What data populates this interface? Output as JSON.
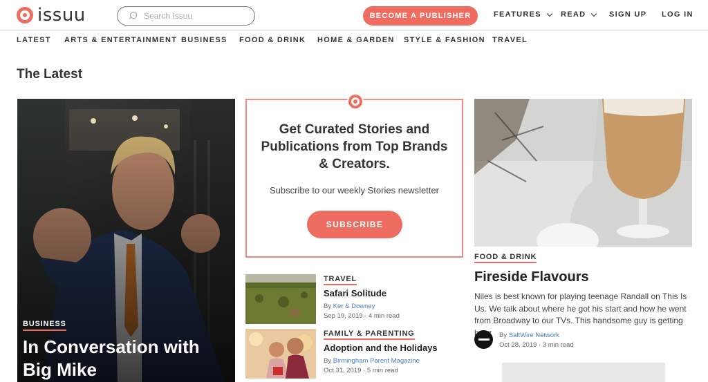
{
  "header": {
    "logo_text": "issuu",
    "search_placeholder": "Search Issuu",
    "publisher_button": "BECOME A PUBLISHER",
    "nav": {
      "features": "FEATURES",
      "read": "READ",
      "signup": "SIGN UP",
      "login": "LOG IN"
    }
  },
  "categories": [
    "LATEST",
    "ARTS & ENTERTAINMENT",
    "BUSINESS",
    "FOOD & DRINK",
    "HOME & GARDEN",
    "STYLE & FASHION",
    "TRAVEL"
  ],
  "section_title": "The Latest",
  "feature": {
    "tag": "BUSINESS",
    "title": "In Conversation with Big Mike"
  },
  "newsletter": {
    "title": "Get Curated Stories and Publications from Top Brands & Creators.",
    "subtitle": "Subscribe to our weekly Stories newsletter",
    "button": "SUBSCRIBE"
  },
  "cards": [
    {
      "tag": "TRAVEL",
      "title": "Safari Solitude",
      "by_prefix": "By ",
      "author": "Ker & Downey",
      "date": "Sep 19, 2019 · 4 min read"
    },
    {
      "tag": "FAMILY & PARENTING",
      "title": "Adoption and the Holidays",
      "by_prefix": "By ",
      "author": "Birmingham Parent Magazine",
      "date": "Oct 31, 2019 · 5 min read"
    }
  ],
  "right_story": {
    "tag": "FOOD & DRINK",
    "title": "Fireside Flavours",
    "description": "Niles is best known for playing teenage Randall on This Is Us. We talk about where he got his start and how he went from Broadway to our TVs. This handsome guy is getting buzz",
    "by_prefix": "By ",
    "author": "SaltWire Network",
    "date": "Oct 28, 2019 · 3 min read"
  },
  "colors": {
    "accent": "#ef6c60",
    "link": "#4a7fc0"
  }
}
